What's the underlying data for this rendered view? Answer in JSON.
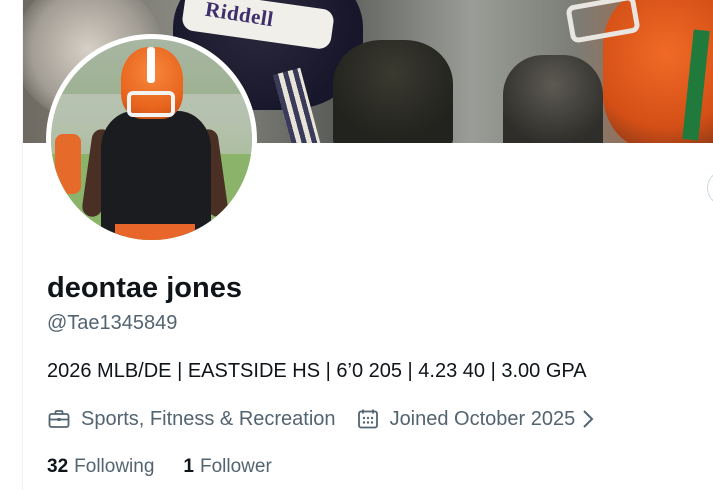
{
  "profile": {
    "display_name": "deontae jones",
    "handle": "@Tae1345849",
    "bio": "2026 MLB/DE | EASTSIDE HS | 6’0 205 | 4.23 40 | 3.00 GPA",
    "category": "Sports, Fitness & Recreation",
    "joined": "Joined October 2025",
    "category_icon": "briefcase-icon",
    "joined_icon": "calendar-icon"
  },
  "banner": {
    "helmet_text": "Riddell"
  },
  "stats": {
    "following_count": "32",
    "following_label": "Following",
    "followers_count": "1",
    "followers_label": "Follower"
  },
  "colors": {
    "text_primary": "#0f1419",
    "text_secondary": "#536471",
    "border": "#cfd9de"
  }
}
